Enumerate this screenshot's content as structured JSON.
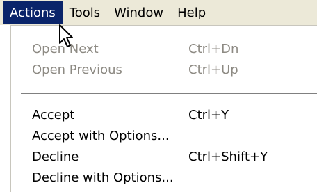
{
  "menubar": {
    "items": [
      {
        "label": "Actions",
        "active": true
      },
      {
        "label": "Tools",
        "active": false
      },
      {
        "label": "Window",
        "active": false
      },
      {
        "label": "Help",
        "active": false
      }
    ]
  },
  "dropdown": {
    "items": [
      {
        "label": "Open Next",
        "shortcut": "Ctrl+Dn",
        "enabled": false
      },
      {
        "label": "Open Previous",
        "shortcut": "Ctrl+Up",
        "enabled": false
      },
      {
        "label": "Accept",
        "shortcut": "Ctrl+Y",
        "enabled": true
      },
      {
        "label": "Accept with Options...",
        "shortcut": "",
        "enabled": true
      },
      {
        "label": "Decline",
        "shortcut": "Ctrl+Shift+Y",
        "enabled": true
      },
      {
        "label": "Decline with Options...",
        "shortcut": "",
        "enabled": true
      }
    ]
  },
  "colors": {
    "menubar_bg": "#ece9d8",
    "highlight": "#0a246a",
    "disabled_text": "#8d8a83",
    "menu_bg": "#ffffff"
  },
  "icons": {
    "cursor": "arrow-cursor-icon"
  }
}
